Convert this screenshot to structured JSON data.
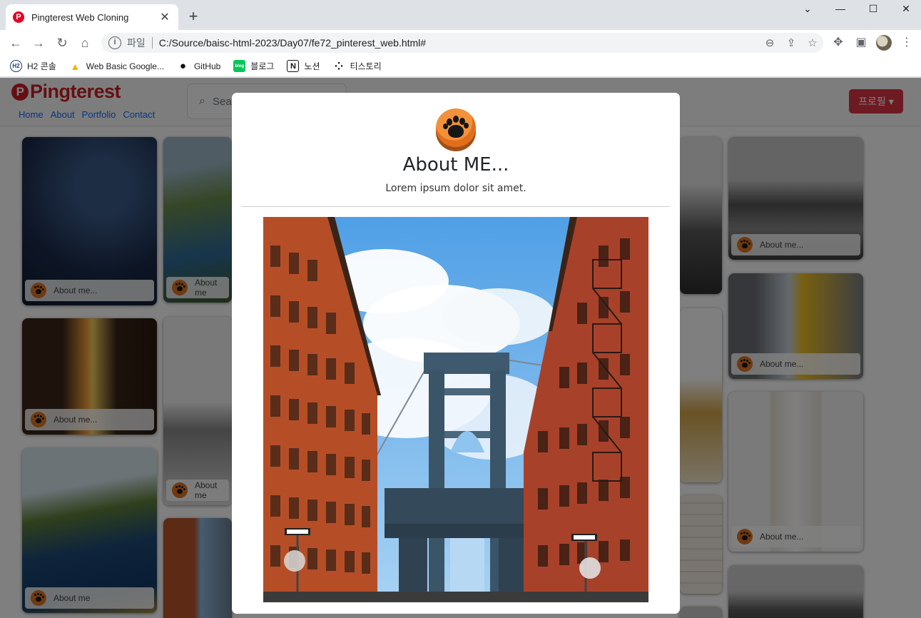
{
  "browser": {
    "tab_title": "Pingterest Web Cloning",
    "tab_favicon": "P",
    "new_tab": "+",
    "close_tab": "✕",
    "window": {
      "minimize": "—",
      "maximize": "☐",
      "close": "✕",
      "tabsearch": "⌄"
    },
    "nav": {
      "back": "←",
      "forward": "→",
      "reload": "↻",
      "home": "⌂"
    },
    "address": {
      "info": "i",
      "scheme": "파일",
      "url": "C:/Source/baisc-html-2023/Day07/fe72_pinterest_web.html#"
    },
    "omnibox_icons": {
      "zoom": "⊖",
      "share": "⇪",
      "star": "☆"
    },
    "toolbar_icons": {
      "extensions": "✥",
      "sidepanel": "▣",
      "menu": "⋮"
    },
    "bookmarks": [
      {
        "label": "H2 콘솔",
        "icon": "h2-icon",
        "glyph": "H2"
      },
      {
        "label": "Web Basic Google...",
        "icon": "google-drive-icon",
        "glyph": "▲"
      },
      {
        "label": "GitHub",
        "icon": "github-icon",
        "glyph": "●"
      },
      {
        "label": "블로그",
        "icon": "blog-icon",
        "glyph": "blog"
      },
      {
        "label": "노션",
        "icon": "notion-icon",
        "glyph": "N"
      },
      {
        "label": "티스토리",
        "icon": "tistory-icon",
        "glyph": "⁘"
      }
    ]
  },
  "page": {
    "logo": "Pingterest",
    "logo_glyph": "P",
    "nav_links": [
      "Home",
      "About",
      "Portfolio",
      "Contact"
    ],
    "search_placeholder": "Sea",
    "search_icon": "⌕",
    "profile_button": "프로필 ▾",
    "card_caption": "About me...",
    "card_caption_cut": "About me"
  },
  "modal": {
    "title": "About ME...",
    "subtitle": "Lorem ipsum dolor sit amet."
  },
  "colors": {
    "brand": "#cb1f27",
    "profile_button": "#dc3545",
    "link": "#0d6efd",
    "paw": "#e07420"
  }
}
